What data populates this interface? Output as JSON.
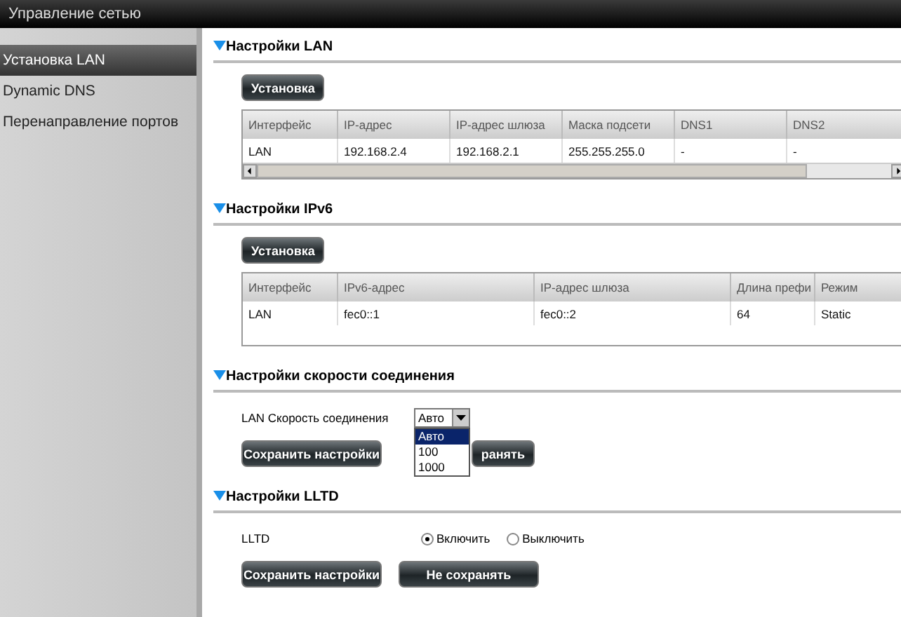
{
  "window": {
    "title": "Управление сетью"
  },
  "sidebar": {
    "items": [
      {
        "label": "Установка LAN",
        "selected": true
      },
      {
        "label": "Dynamic DNS",
        "selected": false
      },
      {
        "label": "Перенаправление портов",
        "selected": false
      }
    ]
  },
  "lan": {
    "title": "Настройки LAN",
    "button": "Установка",
    "columns": [
      "Интерфейс",
      "IP-адрес",
      "IP-адрес шлюза",
      "Маска подсети",
      "DNS1",
      "DNS2"
    ],
    "rows": [
      [
        "LAN",
        "192.168.2.4",
        "192.168.2.1",
        "255.255.255.0",
        "-",
        "-"
      ]
    ]
  },
  "ipv6": {
    "title": "Настройки IPv6",
    "button": "Установка",
    "columns": [
      "Интерфейс",
      "IPv6-адрес",
      "IP-адрес шлюза",
      "Длина префи",
      "Режим"
    ],
    "rows": [
      [
        "LAN",
        "fec0::1",
        "fec0::2",
        "64",
        "Static"
      ]
    ]
  },
  "speed": {
    "title": "Настройки скорости соединения",
    "label": "LAN  Скорость соединения",
    "value": "Авто",
    "expanded": true,
    "options": [
      {
        "label": "Авто",
        "selected": true
      },
      {
        "label": "100",
        "selected": false
      },
      {
        "label": "1000",
        "selected": false
      }
    ],
    "buttons": [
      "Сохранить настройки",
      "ранять"
    ]
  },
  "lltd": {
    "title": "Настройки LLTD",
    "label": "LLTD",
    "options": [
      {
        "label": "Включить",
        "selected": true
      },
      {
        "label": "Выключить",
        "selected": false
      }
    ],
    "buttons": [
      "Сохранить настройки",
      "Не сохранять"
    ]
  }
}
